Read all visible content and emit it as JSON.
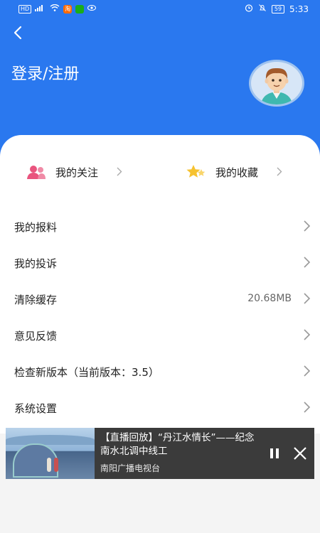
{
  "status_bar": {
    "left_badges": [
      "HD",
      "⁴⁶",
      "淘"
    ],
    "battery": "59",
    "time": "5:33"
  },
  "header": {
    "title": "登录/注册"
  },
  "quick_links": [
    {
      "label": "我的关注"
    },
    {
      "label": "我的收藏"
    }
  ],
  "menu": [
    {
      "label": "我的报料",
      "value": ""
    },
    {
      "label": "我的投诉",
      "value": ""
    },
    {
      "label": "清除缓存",
      "value": "20.68MB"
    },
    {
      "label": "意见反馈",
      "value": ""
    },
    {
      "label": "检查新版本（当前版本：3.5）",
      "value": ""
    },
    {
      "label": "系统设置",
      "value": ""
    }
  ],
  "player": {
    "title": "【直播回放】“丹江水情长”——纪念南水北调中线工",
    "source": "南阳广播电视台"
  },
  "colors": {
    "header_blue": "#2a78ef",
    "player_bg": "#3b3b3b"
  }
}
